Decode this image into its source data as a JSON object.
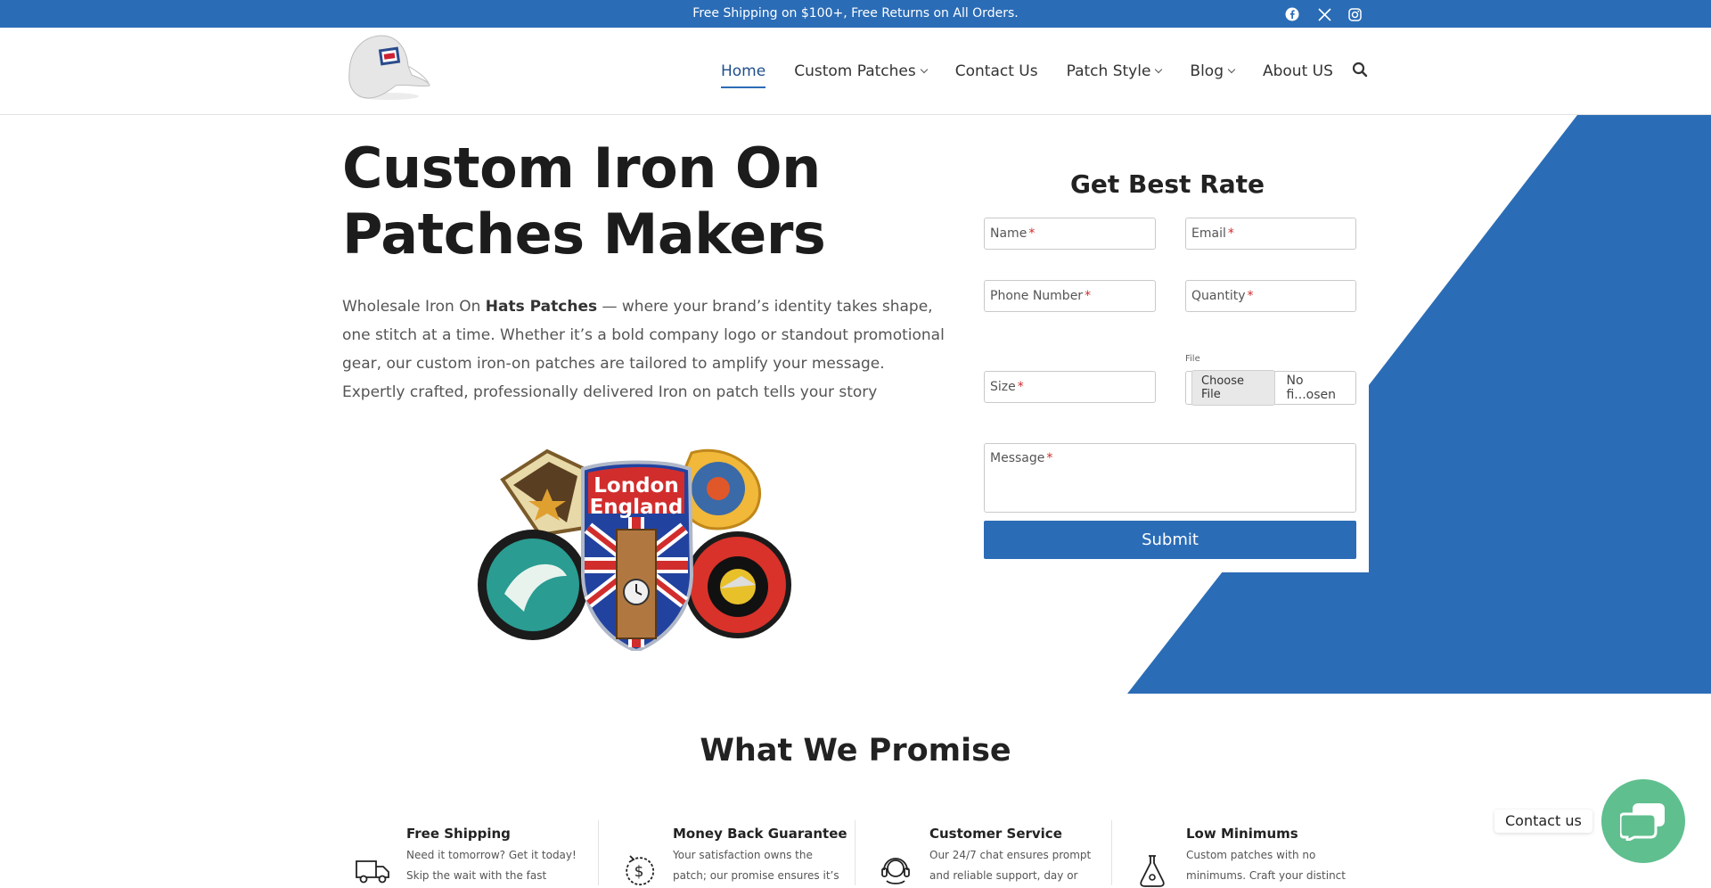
{
  "topbar": {
    "promo": "Free Shipping on $100+, Free Returns on All Orders.",
    "social": [
      "facebook-icon",
      "x-icon",
      "instagram-icon"
    ],
    "color": "#2b6cb6"
  },
  "nav": {
    "items": [
      {
        "label": "Home",
        "active": true,
        "dropdown": false
      },
      {
        "label": "Custom Patches",
        "active": false,
        "dropdown": true
      },
      {
        "label": "Contact Us",
        "active": false,
        "dropdown": false
      },
      {
        "label": "Patch Style",
        "active": false,
        "dropdown": true
      },
      {
        "label": "Blog",
        "active": false,
        "dropdown": true
      },
      {
        "label": "About US",
        "active": false,
        "dropdown": false
      }
    ],
    "search_icon": "search-icon"
  },
  "hero": {
    "title_line1": "Custom Iron On",
    "title_line2": "Patches Makers",
    "text_pre": "Wholesale Iron On ",
    "text_bold": "Hats Patches",
    "text_post": " — where your brand’s identity takes shape, one stitch at a time. Whether it’s a bold company logo or standout promotional gear, our custom iron-on patches are tailored to amplify your message. Expertly crafted, professionally delivered Iron on patch tells your story",
    "patch_text_line1": "London",
    "patch_text_line2": "England"
  },
  "form": {
    "title": "Get Best Rate",
    "name": "Name",
    "email": "Email",
    "phone": "Phone Number",
    "quantity": "Quantity",
    "size": "Size",
    "file_label": "File",
    "file_button": "Choose File",
    "file_status": "No fi...osen",
    "message": "Message",
    "required_mark": "*",
    "submit": "Submit"
  },
  "promise": {
    "title": "What We Promise",
    "items": [
      {
        "title": "Free Shipping",
        "line1": "Need it tomorrow? Get it today!",
        "line2": "Skip the wait with the fast",
        "icon": "truck-icon"
      },
      {
        "title": "Money Back Guarantee",
        "line1": "Your satisfaction owns the",
        "line2": "patch; our promise ensures it’s",
        "icon": "money-back-icon"
      },
      {
        "title": "Customer Service",
        "line1": "Our 24/7 chat ensures prompt",
        "line2": "and reliable support, day or",
        "icon": "headset-icon"
      },
      {
        "title": "Low Minimums",
        "line1": "Custom patches with no",
        "line2": "minimums. Craft your distinct",
        "icon": "low-minimum-icon"
      }
    ]
  },
  "contact_widget": {
    "label": "Contact us",
    "icon": "chat-icon",
    "color": "#5fbf8f"
  }
}
